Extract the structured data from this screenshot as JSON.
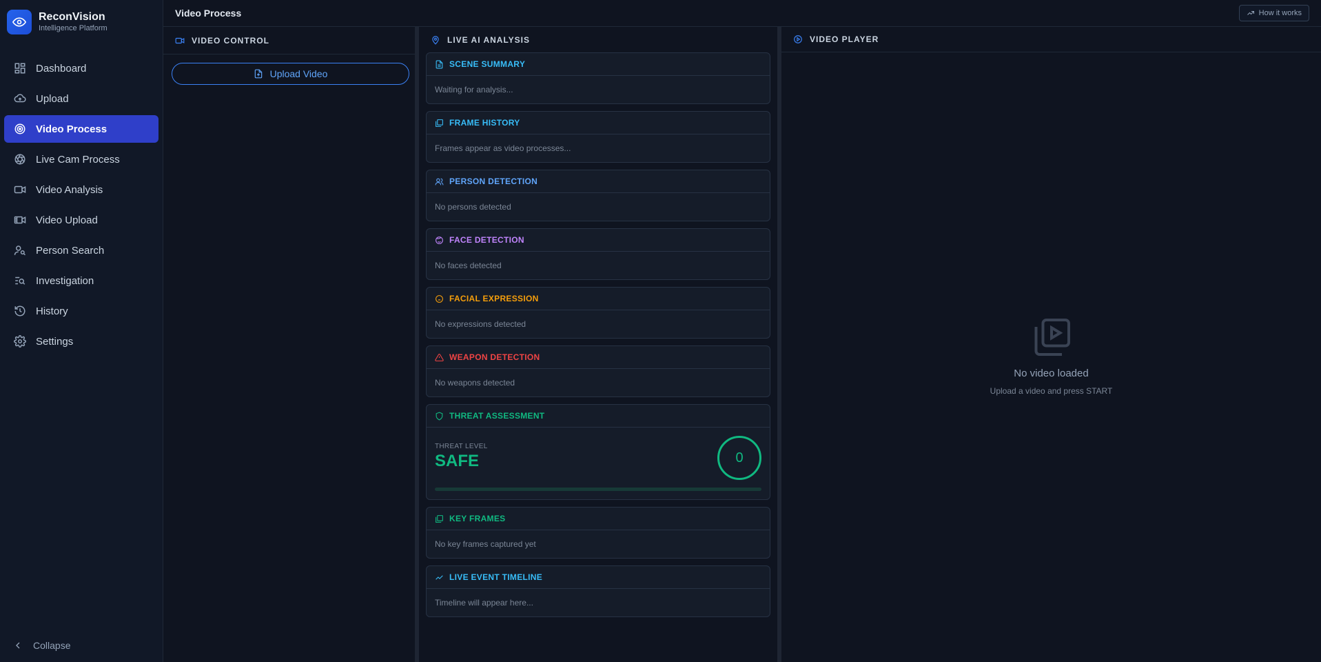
{
  "brand": {
    "name": "ReconVision",
    "subtitle": "Intelligence Platform"
  },
  "sidebar": {
    "items": [
      {
        "label": "Dashboard",
        "icon": "dashboard-icon",
        "active": false
      },
      {
        "label": "Upload",
        "icon": "cloud-upload-icon",
        "active": false
      },
      {
        "label": "Video Process",
        "icon": "target-icon",
        "active": true
      },
      {
        "label": "Live Cam Process",
        "icon": "aperture-icon",
        "active": false
      },
      {
        "label": "Video Analysis",
        "icon": "video-camera-icon",
        "active": false
      },
      {
        "label": "Video Upload",
        "icon": "film-icon",
        "active": false
      },
      {
        "label": "Person Search",
        "icon": "person-search-icon",
        "active": false
      },
      {
        "label": "Investigation",
        "icon": "list-search-icon",
        "active": false
      },
      {
        "label": "History",
        "icon": "history-icon",
        "active": false
      },
      {
        "label": "Settings",
        "icon": "gear-icon",
        "active": false
      }
    ],
    "collapse_label": "Collapse"
  },
  "topbar": {
    "title": "Video Process",
    "how_label": "How it works"
  },
  "control": {
    "title": "VIDEO CONTROL",
    "upload_label": "Upload Video"
  },
  "analysis": {
    "title": "LIVE AI ANALYSIS",
    "cards": {
      "scene": {
        "title": "SCENE SUMMARY",
        "text": "Waiting for analysis...",
        "color": "#38bdf8"
      },
      "frames": {
        "title": "FRAME HISTORY",
        "text": "Frames appear as video processes...",
        "color": "#38bdf8"
      },
      "person": {
        "title": "PERSON DETECTION",
        "text": "No persons detected",
        "color": "#60a5fa"
      },
      "face": {
        "title": "FACE DETECTION",
        "text": "No faces detected",
        "color": "#c084fc"
      },
      "expression": {
        "title": "FACIAL EXPRESSION",
        "text": "No expressions detected",
        "color": "#f59e0b"
      },
      "weapon": {
        "title": "WEAPON DETECTION",
        "text": "No weapons detected",
        "color": "#ef4444"
      },
      "threat": {
        "title": "THREAT ASSESSMENT",
        "level_label": "THREAT LEVEL",
        "level": "SAFE",
        "score": "0",
        "progress": 0,
        "color": "#10b981"
      },
      "keyframes": {
        "title": "KEY FRAMES",
        "text": "No key frames captured yet",
        "color": "#10b981"
      },
      "timeline": {
        "title": "LIVE EVENT TIMELINE",
        "text": "Timeline will appear here...",
        "color": "#38bdf8"
      }
    }
  },
  "player": {
    "title": "VIDEO PLAYER",
    "empty_title": "No video loaded",
    "empty_sub": "Upload a video and press START"
  }
}
